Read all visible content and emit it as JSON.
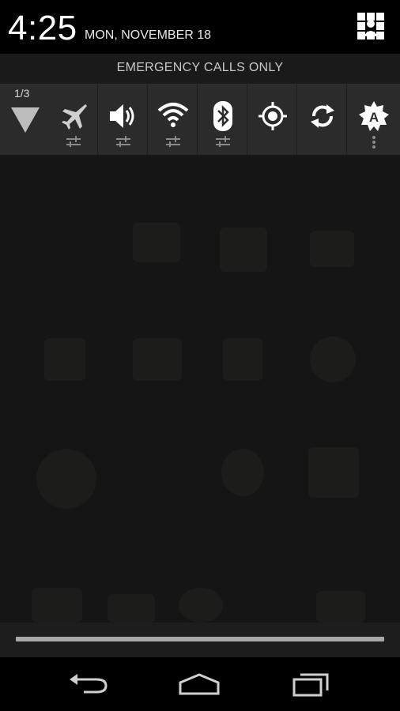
{
  "status": {
    "time": "4:25",
    "date": "MON, NOVEMBER 18"
  },
  "carrier": {
    "text": "EMERGENCY CALLS ONLY"
  },
  "quick_settings": {
    "page_indicator": "1/3",
    "tiles": [
      {
        "name": "airplane-mode",
        "icon": "airplane-icon",
        "has_settings": true
      },
      {
        "name": "sound",
        "icon": "volume-icon",
        "has_settings": true
      },
      {
        "name": "wifi",
        "icon": "wifi-icon",
        "has_settings": true
      },
      {
        "name": "bluetooth",
        "icon": "bluetooth-icon",
        "has_settings": true
      },
      {
        "name": "location",
        "icon": "location-icon",
        "has_settings": false
      },
      {
        "name": "sync",
        "icon": "sync-icon",
        "has_settings": false
      },
      {
        "name": "auto-brightness",
        "icon": "brightness-auto-icon",
        "has_settings": false,
        "has_overflow": true
      }
    ],
    "brightness_auto_letter": "A"
  },
  "nav": {
    "buttons": [
      "back-icon",
      "home-icon",
      "recents-icon"
    ]
  },
  "colors": {
    "accent": "#ffffff",
    "panel": "#2b2b2b",
    "background": "#000000"
  }
}
